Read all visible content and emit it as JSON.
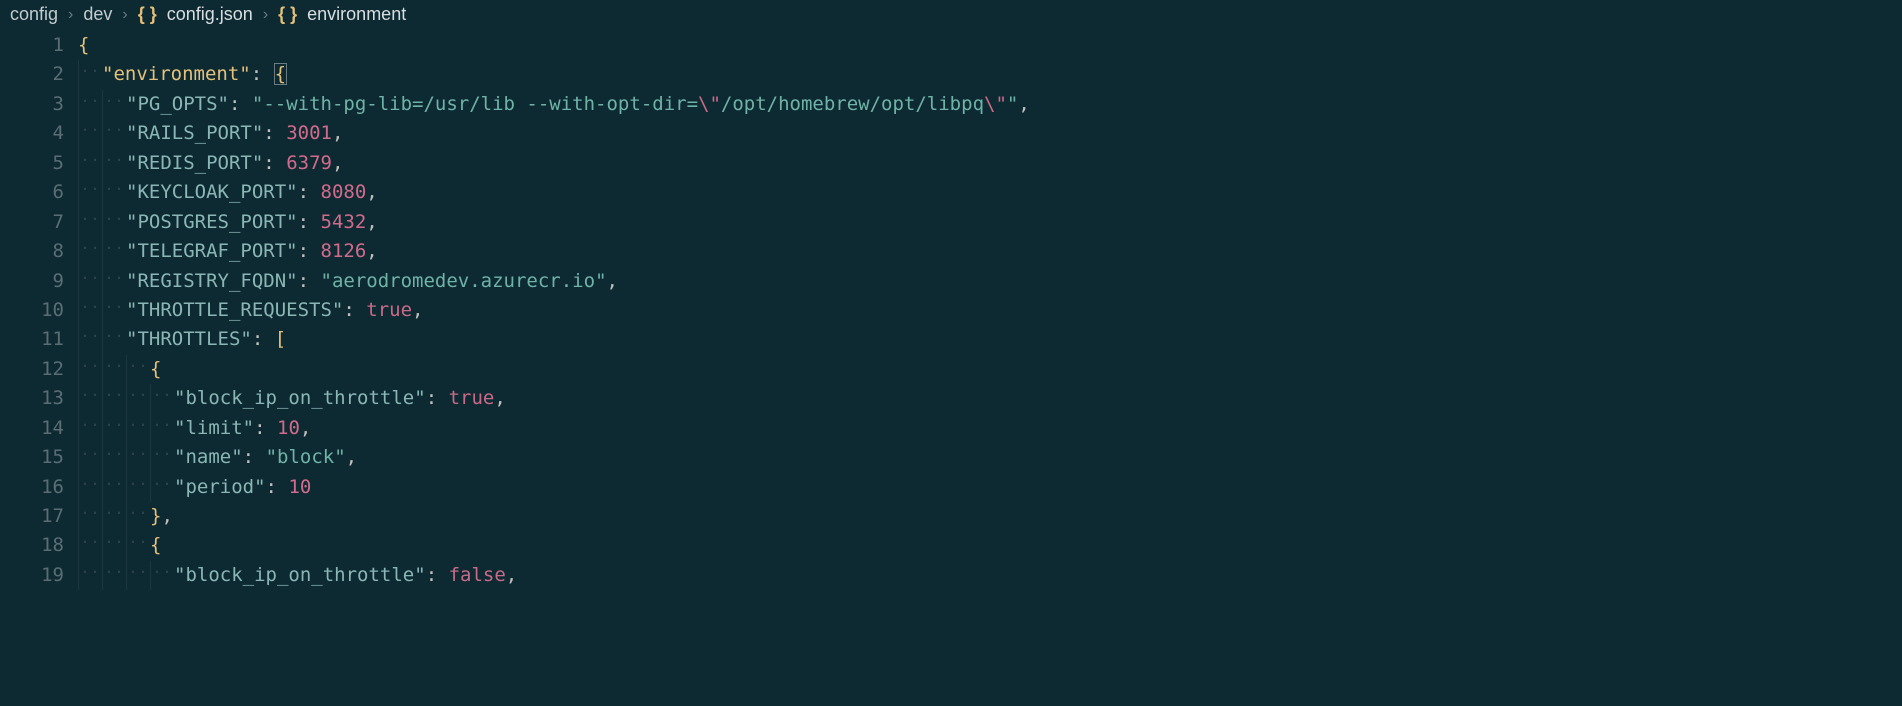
{
  "breadcrumb": {
    "segments": [
      {
        "label": "config",
        "icon": null
      },
      {
        "label": "dev",
        "icon": null
      },
      {
        "label": "config.json",
        "icon": "braces"
      },
      {
        "label": "environment",
        "icon": "braces"
      }
    ]
  },
  "editor": {
    "lines": [
      {
        "num": 1,
        "indent": 0,
        "tokens": [
          {
            "t": "brace",
            "v": "{"
          }
        ]
      },
      {
        "num": 2,
        "indent": 1,
        "tokens": [
          {
            "t": "hlkey",
            "v": "environment"
          },
          {
            "t": "colon",
            "v": ": "
          },
          {
            "t": "cursor-brace",
            "v": "{"
          }
        ]
      },
      {
        "num": 3,
        "indent": 2,
        "tokens": [
          {
            "t": "key",
            "v": "PG_OPTS"
          },
          {
            "t": "colon",
            "v": ": "
          },
          {
            "t": "strq",
            "v": "\""
          },
          {
            "t": "str",
            "v": "--with-pg-lib=/usr/lib --with-opt-dir="
          },
          {
            "t": "esc",
            "v": "\\\""
          },
          {
            "t": "str",
            "v": "/opt/homebrew/opt/libpq"
          },
          {
            "t": "esc",
            "v": "\\\""
          },
          {
            "t": "strq",
            "v": "\""
          },
          {
            "t": "punc",
            "v": ","
          }
        ]
      },
      {
        "num": 4,
        "indent": 2,
        "tokens": [
          {
            "t": "key",
            "v": "RAILS_PORT"
          },
          {
            "t": "colon",
            "v": ": "
          },
          {
            "t": "num",
            "v": "3001"
          },
          {
            "t": "punc",
            "v": ","
          }
        ]
      },
      {
        "num": 5,
        "indent": 2,
        "tokens": [
          {
            "t": "key",
            "v": "REDIS_PORT"
          },
          {
            "t": "colon",
            "v": ": "
          },
          {
            "t": "num",
            "v": "6379"
          },
          {
            "t": "punc",
            "v": ","
          }
        ]
      },
      {
        "num": 6,
        "indent": 2,
        "tokens": [
          {
            "t": "key",
            "v": "KEYCLOAK_PORT"
          },
          {
            "t": "colon",
            "v": ": "
          },
          {
            "t": "num",
            "v": "8080"
          },
          {
            "t": "punc",
            "v": ","
          }
        ]
      },
      {
        "num": 7,
        "indent": 2,
        "tokens": [
          {
            "t": "key",
            "v": "POSTGRES_PORT"
          },
          {
            "t": "colon",
            "v": ": "
          },
          {
            "t": "num",
            "v": "5432"
          },
          {
            "t": "punc",
            "v": ","
          }
        ]
      },
      {
        "num": 8,
        "indent": 2,
        "tokens": [
          {
            "t": "key",
            "v": "TELEGRAF_PORT"
          },
          {
            "t": "colon",
            "v": ": "
          },
          {
            "t": "num",
            "v": "8126"
          },
          {
            "t": "punc",
            "v": ","
          }
        ]
      },
      {
        "num": 9,
        "indent": 2,
        "tokens": [
          {
            "t": "key",
            "v": "REGISTRY_FQDN"
          },
          {
            "t": "colon",
            "v": ": "
          },
          {
            "t": "strq",
            "v": "\""
          },
          {
            "t": "str",
            "v": "aerodromedev.azurecr.io"
          },
          {
            "t": "strq",
            "v": "\""
          },
          {
            "t": "punc",
            "v": ","
          }
        ]
      },
      {
        "num": 10,
        "indent": 2,
        "tokens": [
          {
            "t": "key",
            "v": "THROTTLE_REQUESTS"
          },
          {
            "t": "colon",
            "v": ": "
          },
          {
            "t": "bool",
            "v": "true"
          },
          {
            "t": "punc",
            "v": ","
          }
        ]
      },
      {
        "num": 11,
        "indent": 2,
        "tokens": [
          {
            "t": "key",
            "v": "THROTTLES"
          },
          {
            "t": "colon",
            "v": ": "
          },
          {
            "t": "brace",
            "v": "["
          }
        ]
      },
      {
        "num": 12,
        "indent": 3,
        "tokens": [
          {
            "t": "brace",
            "v": "{"
          }
        ]
      },
      {
        "num": 13,
        "indent": 4,
        "tokens": [
          {
            "t": "key",
            "v": "block_ip_on_throttle"
          },
          {
            "t": "colon",
            "v": ": "
          },
          {
            "t": "bool",
            "v": "true"
          },
          {
            "t": "punc",
            "v": ","
          }
        ]
      },
      {
        "num": 14,
        "indent": 4,
        "tokens": [
          {
            "t": "key",
            "v": "limit"
          },
          {
            "t": "colon",
            "v": ": "
          },
          {
            "t": "num",
            "v": "10"
          },
          {
            "t": "punc",
            "v": ","
          }
        ]
      },
      {
        "num": 15,
        "indent": 4,
        "tokens": [
          {
            "t": "key",
            "v": "name"
          },
          {
            "t": "colon",
            "v": ": "
          },
          {
            "t": "strq",
            "v": "\""
          },
          {
            "t": "str",
            "v": "block"
          },
          {
            "t": "strq",
            "v": "\""
          },
          {
            "t": "punc",
            "v": ","
          }
        ]
      },
      {
        "num": 16,
        "indent": 4,
        "tokens": [
          {
            "t": "key",
            "v": "period"
          },
          {
            "t": "colon",
            "v": ": "
          },
          {
            "t": "num",
            "v": "10"
          }
        ]
      },
      {
        "num": 17,
        "indent": 3,
        "tokens": [
          {
            "t": "brace",
            "v": "}"
          },
          {
            "t": "punc",
            "v": ","
          }
        ]
      },
      {
        "num": 18,
        "indent": 3,
        "tokens": [
          {
            "t": "brace",
            "v": "{"
          }
        ]
      },
      {
        "num": 19,
        "indent": 4,
        "tokens": [
          {
            "t": "key",
            "v": "block_ip_on_throttle"
          },
          {
            "t": "colon",
            "v": ": "
          },
          {
            "t": "bool",
            "v": "false"
          },
          {
            "t": "punc",
            "v": ","
          }
        ]
      }
    ]
  }
}
